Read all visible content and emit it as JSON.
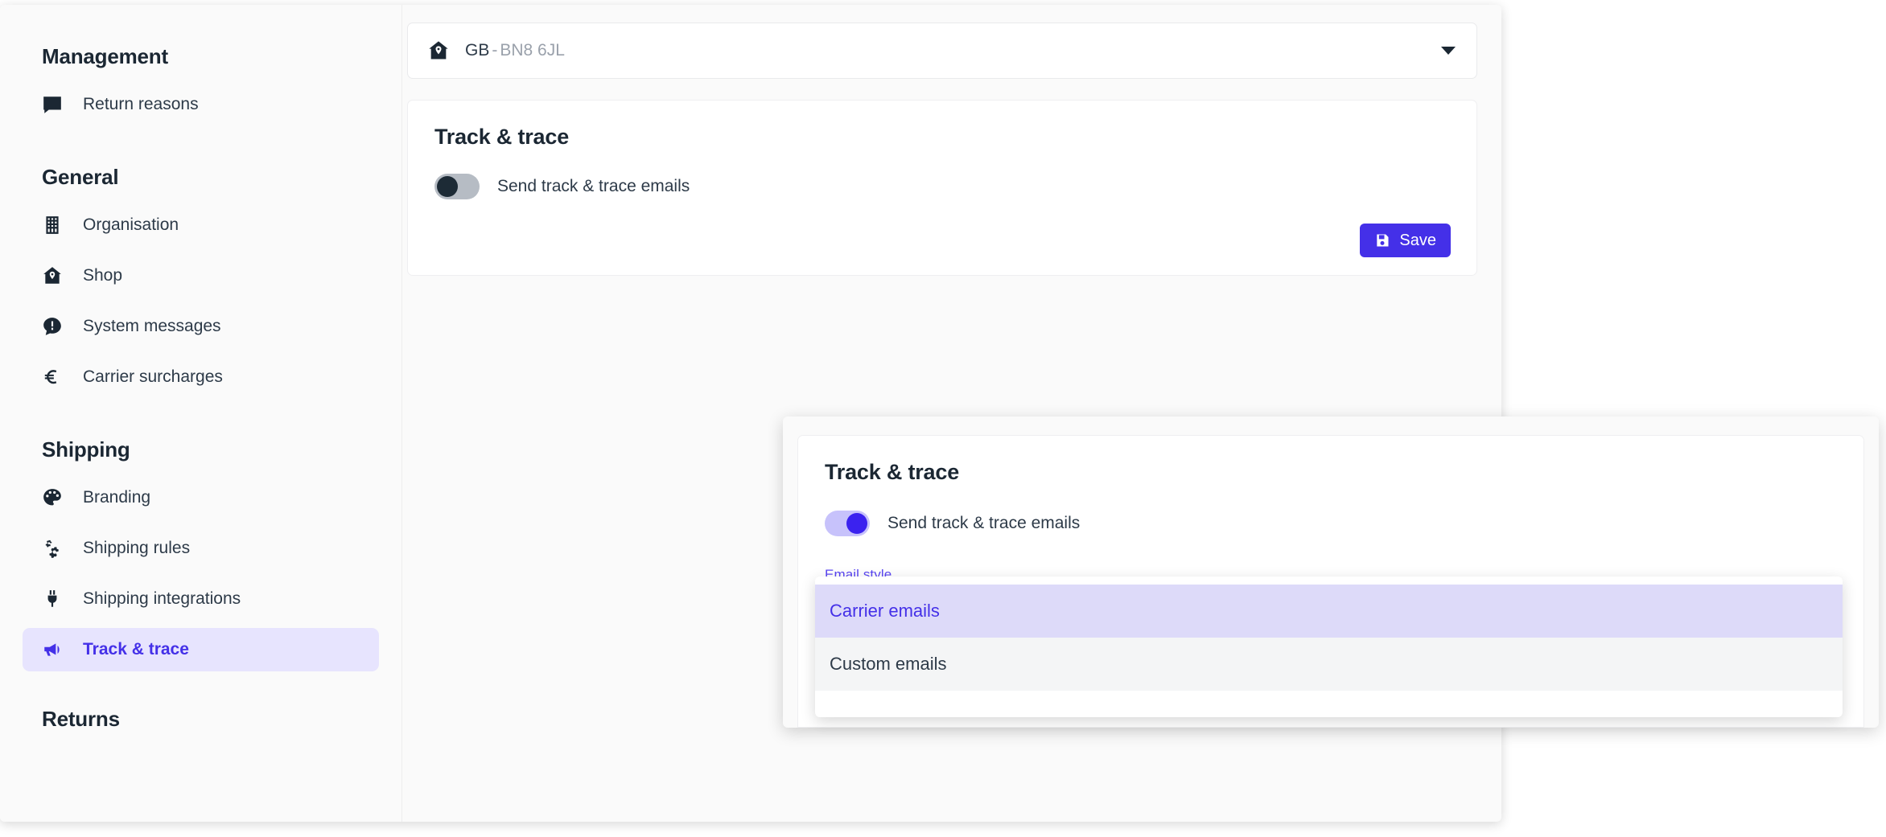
{
  "theme": {
    "accent": "#4430e8",
    "accent_soft": "#e7e4fe",
    "accent_option_bg": "#dddaf9",
    "toggle_on_track": "#c7c2fb",
    "toggle_on_knob": "#3b22ef",
    "toggle_off_track": "#b6bcc4",
    "toggle_off_knob": "#1d2b36",
    "text_dark": "#1b2733",
    "text_muted": "#9aa1ab"
  },
  "sidebar": {
    "sections": [
      {
        "title": "Management",
        "items": [
          {
            "label": "Return reasons",
            "icon": "comment-list-icon",
            "active": false
          }
        ]
      },
      {
        "title": "General",
        "items": [
          {
            "label": "Organisation",
            "icon": "building-icon",
            "active": false
          },
          {
            "label": "Shop",
            "icon": "shop-home-pin-icon",
            "active": false
          },
          {
            "label": "System messages",
            "icon": "comment-exclamation-icon",
            "active": false
          },
          {
            "label": "Carrier surcharges",
            "icon": "euro-icon",
            "active": false
          }
        ]
      },
      {
        "title": "Shipping",
        "items": [
          {
            "label": "Branding",
            "icon": "palette-icon",
            "active": false
          },
          {
            "label": "Shipping rules",
            "icon": "gears-icon",
            "active": false
          },
          {
            "label": "Shipping integrations",
            "icon": "plug-icon",
            "active": false
          },
          {
            "label": "Track & trace",
            "icon": "megaphone-icon",
            "active": true
          }
        ]
      },
      {
        "title": "Returns",
        "items": []
      }
    ]
  },
  "shop_selector": {
    "icon": "shop-home-pin-icon",
    "country": "GB",
    "separator": "-",
    "postcode": "BN8 6JL",
    "caret": "chevron-down-icon"
  },
  "main_card": {
    "title": "Track & trace",
    "toggle": {
      "label": "Send track & trace emails",
      "state": "off"
    },
    "save_label": "Save",
    "save_icon": "save-floppy-icon"
  },
  "overlay_card": {
    "title": "Track & trace",
    "toggle": {
      "label": "Send track & trace emails",
      "state": "on"
    },
    "field_label": "Email style"
  },
  "dropdown": {
    "options": [
      {
        "label": "Carrier emails",
        "selected": true
      },
      {
        "label": "Custom emails",
        "selected": false
      }
    ]
  }
}
